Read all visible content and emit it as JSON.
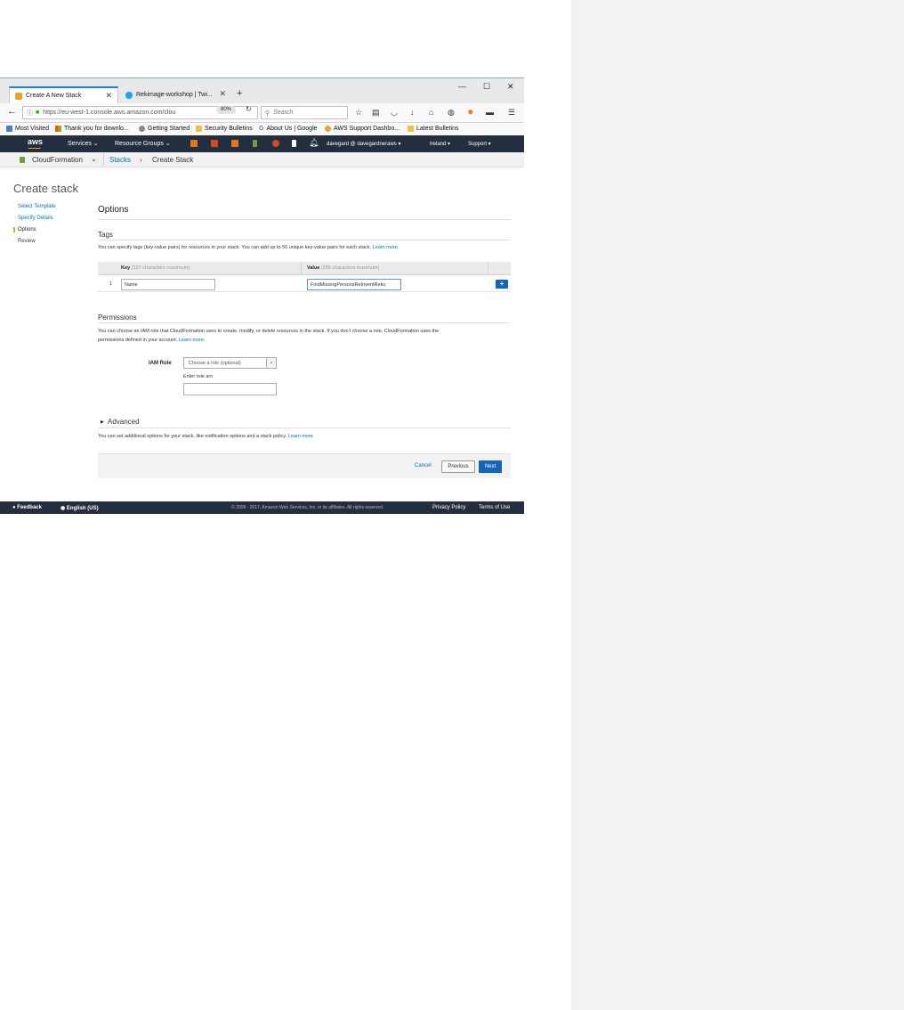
{
  "browser": {
    "tabs": [
      {
        "label": "Create A New Stack",
        "active": true
      },
      {
        "label": "Rekimage-workshop | Twi...",
        "active": false
      }
    ],
    "url": "https://eu-west-1.console.aws.amazon.com/clou",
    "zoom": "80%",
    "search_placeholder": "Search",
    "bookmarks": [
      "Most Visited",
      "Thank you for downlo...",
      "Getting Started",
      "Security Bulletins",
      "About Us | Google",
      "AWS Support Dashbo...",
      "Latest Bulletins"
    ]
  },
  "aws_nav": {
    "logo": "aws",
    "services": "Services",
    "resource_groups": "Resource Groups",
    "account": "davegard @ davegardneraws",
    "region": "Ireland",
    "support": "Support"
  },
  "breadcrumb": {
    "service": "CloudFormation",
    "stacks": "Stacks",
    "arrow": "›",
    "current": "Create Stack"
  },
  "page": {
    "title": "Create stack",
    "steps": [
      "Select Template",
      "Specify Details",
      "Options",
      "Review"
    ],
    "heading": "Options"
  },
  "tags": {
    "heading": "Tags",
    "description": "You can specify tags (key-value pairs) for resources in your stack. You can add up to 50 unique key-value pairs for each stack.",
    "learn_more": "Learn more.",
    "key_header": "Key",
    "key_hint": "(127 characters maximum)",
    "value_header": "Value",
    "value_hint": "(255 characters maximum)",
    "rows": [
      {
        "index": "1",
        "key": "Name",
        "value": "FindMissingPersonsReInventReko"
      }
    ],
    "add_button": "+"
  },
  "permissions": {
    "heading": "Permissions",
    "description_line1": "You can choose an IAM role that CloudFormation uses to create, modify, or delete resources in the stack. If you don't choose a role, CloudFormation uses the",
    "description_line2": "permissions defined in your account.",
    "learn_more": "Learn more.",
    "iam_role_label": "IAM Role",
    "iam_role_placeholder": "Choose a role (optional)",
    "role_arn_label": "Enter role arn",
    "role_arn_value": ""
  },
  "advanced": {
    "heading": "Advanced",
    "description": "You can set additional options for your stack, like notification options and a stack policy.",
    "learn_more": "Learn more."
  },
  "actions": {
    "cancel": "Cancel",
    "previous": "Previous",
    "next": "Next"
  },
  "footer": {
    "feedback": "Feedback",
    "language": "English (US)",
    "copyright": "© 2008 - 2017, Amazon Web Services, Inc. or its affiliates. All rights reserved.",
    "privacy": "Privacy Policy",
    "terms": "Terms of Use"
  },
  "colors": {
    "aws_nav_bg": "#232f3e",
    "link": "#0073bb",
    "primary_button": "#1166bb",
    "active_step_marker": "#e8a23a"
  }
}
